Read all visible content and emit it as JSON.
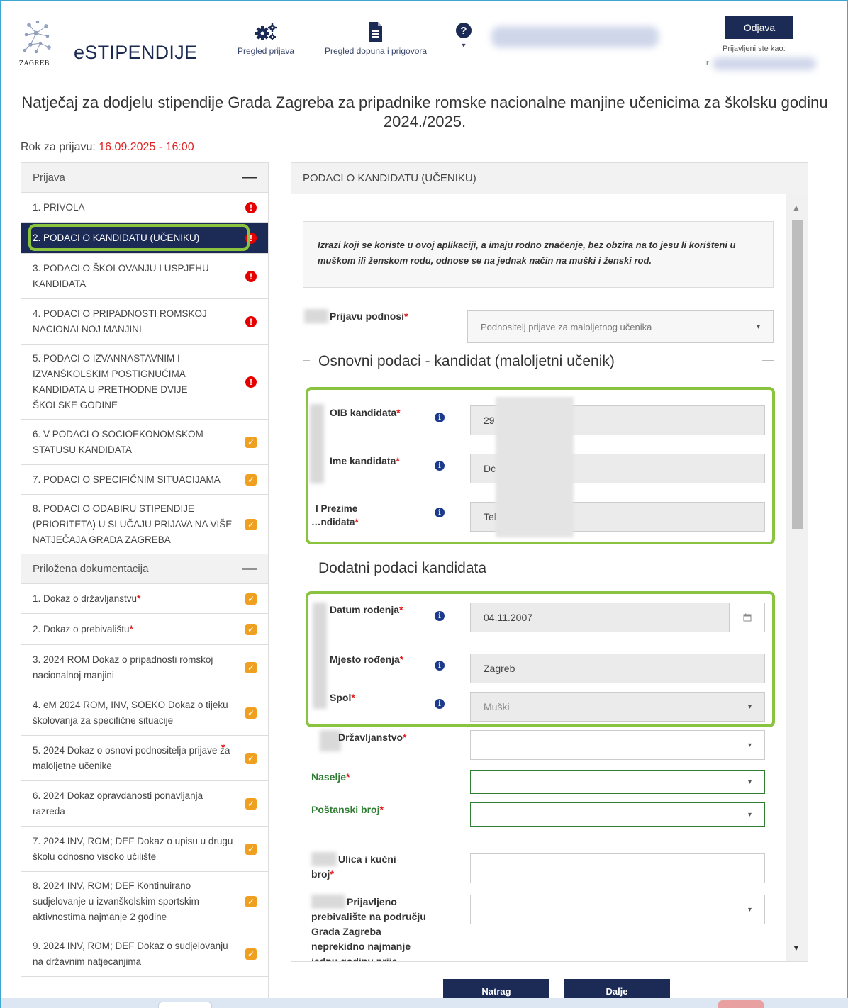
{
  "header": {
    "brand": "eSTIPENDIJE",
    "logo_text": "ZAGREB",
    "nav": [
      {
        "label": "Pregled prijava",
        "icon": "gears-icon"
      },
      {
        "label": "Pregled dopuna i prigovora",
        "icon": "document-icon"
      },
      {
        "label": "",
        "icon": "help-icon"
      }
    ],
    "logout_label": "Odjava",
    "logged_in_label": "Prijavljeni ste kao:",
    "logged_in_prefix": "Ir"
  },
  "page": {
    "title": "Natječaj za dodjelu stipendije Grada Zagreba za pripadnike romske nacionalne manjine učenicima za školsku godinu 2024./2025.",
    "deadline_label": "Rok za prijavu: ",
    "deadline_value": "16.09.2025 - 16:00"
  },
  "sidebar": {
    "section1_title": "Prijava",
    "items": [
      {
        "label": "1. PRIVOLA",
        "status": "error"
      },
      {
        "label": "2. PODACI O KANDIDATU (UČENIKU)",
        "status": "error"
      },
      {
        "label": "3. PODACI O ŠKOLOVANJU I USPJEHU KANDIDATA",
        "status": "error"
      },
      {
        "label": "4. PODACI O PRIPADNOSTI ROMSKOJ NACIONALNOJ MANJINI",
        "status": "error"
      },
      {
        "label": "5. PODACI O IZVANNASTAVNIM I IZVANŠKOLSKIM POSTIGNUĆIMA KANDIDATA U PRETHODNE DVIJE ŠKOLSKE GODINE",
        "status": "error"
      },
      {
        "label": "6. V PODACI O SOCIOEKONOMSKOM STATUSU KANDIDATA",
        "status": "ok"
      },
      {
        "label": "7. PODACI O SPECIFIČNIM SITUACIJAMA",
        "status": "ok"
      },
      {
        "label": "8. PODACI O ODABIRU STIPENDIJE (PRIORITETA) U SLUČAJU PRIJAVA NA VIŠE NATJEČAJA GRADA ZAGREBA",
        "status": "ok"
      }
    ],
    "section2_title": "Priložena dokumentacija",
    "docs": [
      {
        "label": "1. Dokaz o državljanstvu",
        "required": "*",
        "status": "ok"
      },
      {
        "label": "2. Dokaz o prebivalištu",
        "required": "*",
        "status": "ok"
      },
      {
        "label": "3. 2024 ROM Dokaz o pripadnosti romskoj nacionalnoj manjini",
        "required": "",
        "status": "ok"
      },
      {
        "label": "4. eM 2024 ROM, INV, SOEKO Dokaz o tijeku školovanja za specifične situacije",
        "required": "",
        "status": "ok"
      },
      {
        "label": "5. 2024 Dokaz o osnovi podnositelja prijave za maloljetne učenike",
        "required": "*",
        "status": "ok"
      },
      {
        "label": "6. 2024 Dokaz opravdanosti ponavljanja razreda",
        "required": "",
        "status": "ok"
      },
      {
        "label": "7. 2024 INV, ROM; DEF Dokaz o upisu u drugu školu odnosno visoko učilište",
        "required": "",
        "status": "ok"
      },
      {
        "label": "8. 2024 INV, ROM; DEF Kontinuirano sudjelovanje u izvanškolskim sportskim aktivnostima najmanje 2 godine",
        "required": "",
        "status": "ok"
      },
      {
        "label": "9. 2024 INV, ROM; DEF Dokaz o sudjelovanju na državnim natjecanjima",
        "required": "",
        "status": "ok"
      }
    ]
  },
  "main": {
    "heading": "PODACI O KANDIDATU (UČENIKU)",
    "notice": "Izrazi koji se koriste u ovoj aplikaciji, a imaju rodno značenje, bez obzira na to jesu li korišteni u muškom ili ženskom rodu, odnose se na jednak način na muški i ženski rod.",
    "prijavu_label": "Prijavu podnosi",
    "prijavu_value": "Podnositelj prijave za maloljetnog učenika",
    "section_basic": "Osnovni podaci - kandidat (maloljetni učenik)",
    "oib_label": "OIB kandidata",
    "oib_value": "29",
    "ime_label": "Ime kandidata",
    "ime_value": "Dc",
    "prezime_label_1": "l Prezime",
    "prezime_label_2": "…ndidata",
    "prezime_value": "Tel",
    "section_extra": "Dodatni podaci kandidata",
    "datum_label": "Datum rođenja",
    "datum_value": "04.11.2007",
    "mjesto_label": "Mjesto rođenja",
    "mjesto_value": "Zagreb",
    "spol_label": "Spol",
    "spol_value": "Muški",
    "drz_label": "Državljanstvo",
    "naselje_label": "Naselje",
    "postanski_label": "Poštanski broj",
    "ulica_label_1": "Ulica i kućni",
    "ulica_label_2": "broj",
    "prebivaliste_label_1": "Prijavljeno",
    "prebivaliste_label_2": "prebivalište na području",
    "prebivaliste_label_3": "Grada Zagreba",
    "prebivaliste_label_4": "neprekidno najmanje",
    "prebivaliste_label_5": "jednu godinu prije",
    "req": "*"
  },
  "footer": {
    "back_label": "Natrag",
    "next_label": "Dalje"
  },
  "colors": {
    "navy": "#1c2b55",
    "error_red": "#e50000",
    "ok_orange": "#f0a020",
    "highlight_green": "#8ac43f"
  }
}
